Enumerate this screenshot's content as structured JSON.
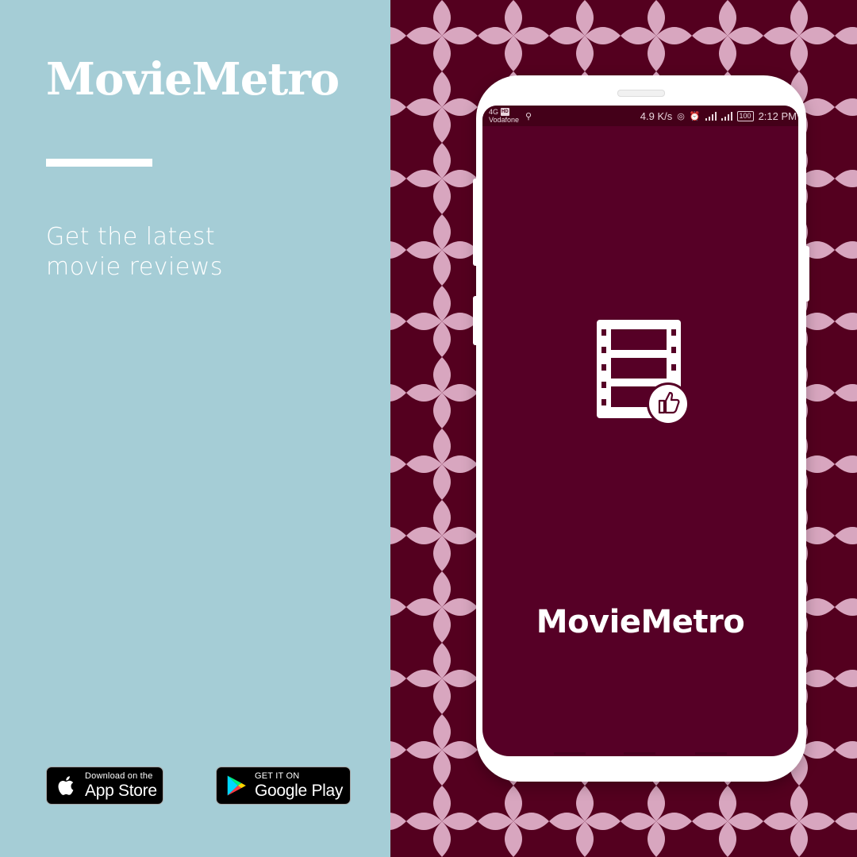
{
  "left": {
    "title": "MovieMetro",
    "tagline": [
      "Get the latest",
      "movie reviews"
    ],
    "app_store": {
      "small": "Download on the",
      "big": "App Store"
    },
    "google_play": {
      "small": "GET IT ON",
      "big": "Google Play"
    }
  },
  "phone": {
    "status_bar": {
      "network": "4G",
      "hd": "HD",
      "carrier": "Vodafone",
      "speed": "4.9 K/s",
      "battery": "100",
      "time": "2:12 PM"
    },
    "splash_title": "MovieMetro"
  },
  "icons": [
    "apple-icon",
    "google-play-icon",
    "usb-icon",
    "hotspot-icon",
    "alarm-icon",
    "signal-icon",
    "battery-icon",
    "film-strip-icon",
    "thumbs-up-icon"
  ],
  "colors": {
    "left_bg": "#a5cdd6",
    "pattern_dark": "#54001f",
    "pattern_light": "#d8a6bf",
    "screen_bg": "#560026",
    "text": "#ffffff"
  }
}
